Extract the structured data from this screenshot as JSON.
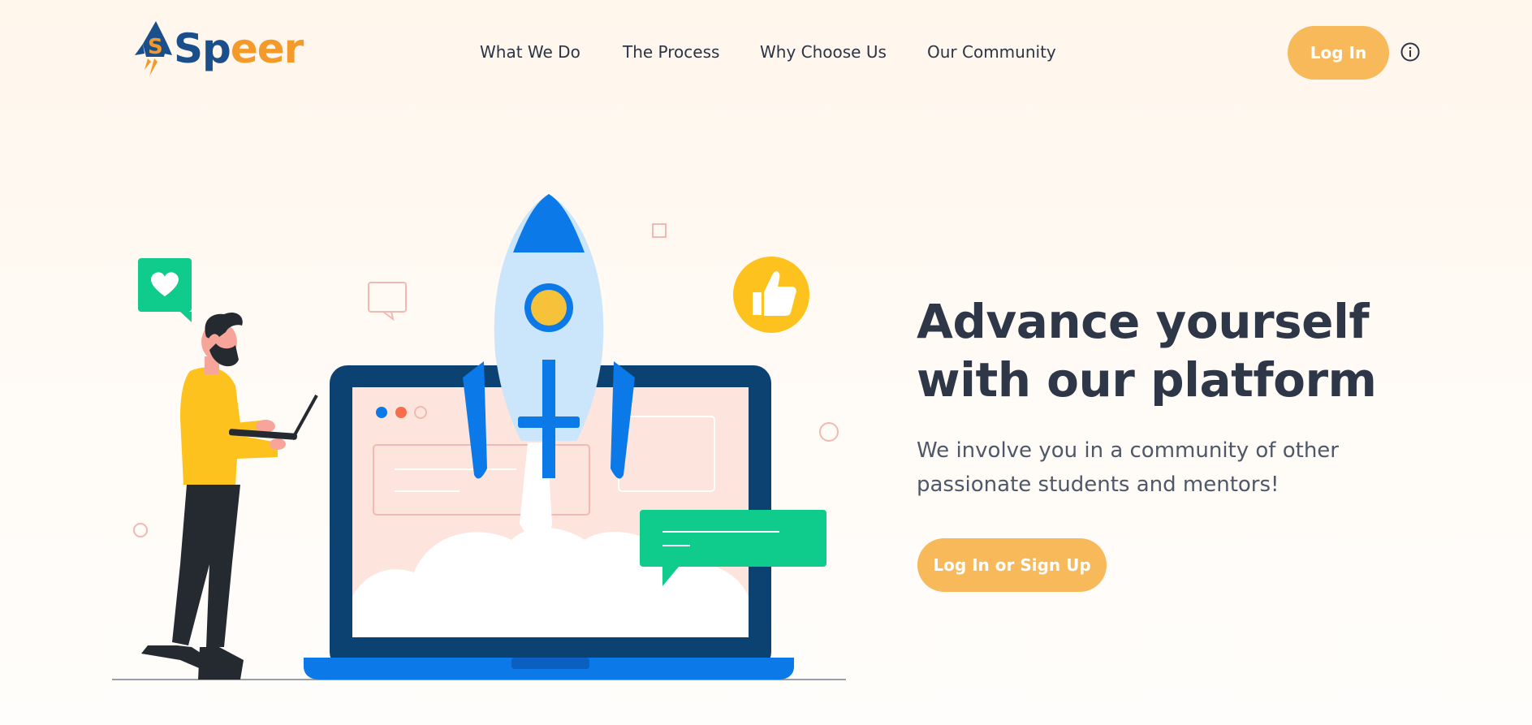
{
  "brand": {
    "name_part1": "Sp",
    "name_part2": "eer",
    "primary_color": "#1a4f8b",
    "accent_color": "#f49a2a"
  },
  "nav": {
    "items": [
      {
        "label": "What We Do"
      },
      {
        "label": "The Process"
      },
      {
        "label": "Why Choose Us"
      },
      {
        "label": "Our Community"
      }
    ]
  },
  "header": {
    "login_label": "Log In",
    "info_icon": "info-icon",
    "button_color": "#f8b95a"
  },
  "hero": {
    "title_line1": "Advance yourself",
    "title_line2": "with our platform",
    "subtitle_line1": "We involve you in a community of other",
    "subtitle_line2": "passionate students and mentors!",
    "cta_label": "Log In or Sign Up"
  },
  "illustration": {
    "icons": [
      "rocket-icon",
      "laptop-icon",
      "person-icon",
      "heart-icon",
      "thumbs-up-icon",
      "chat-bubble-icon"
    ]
  }
}
